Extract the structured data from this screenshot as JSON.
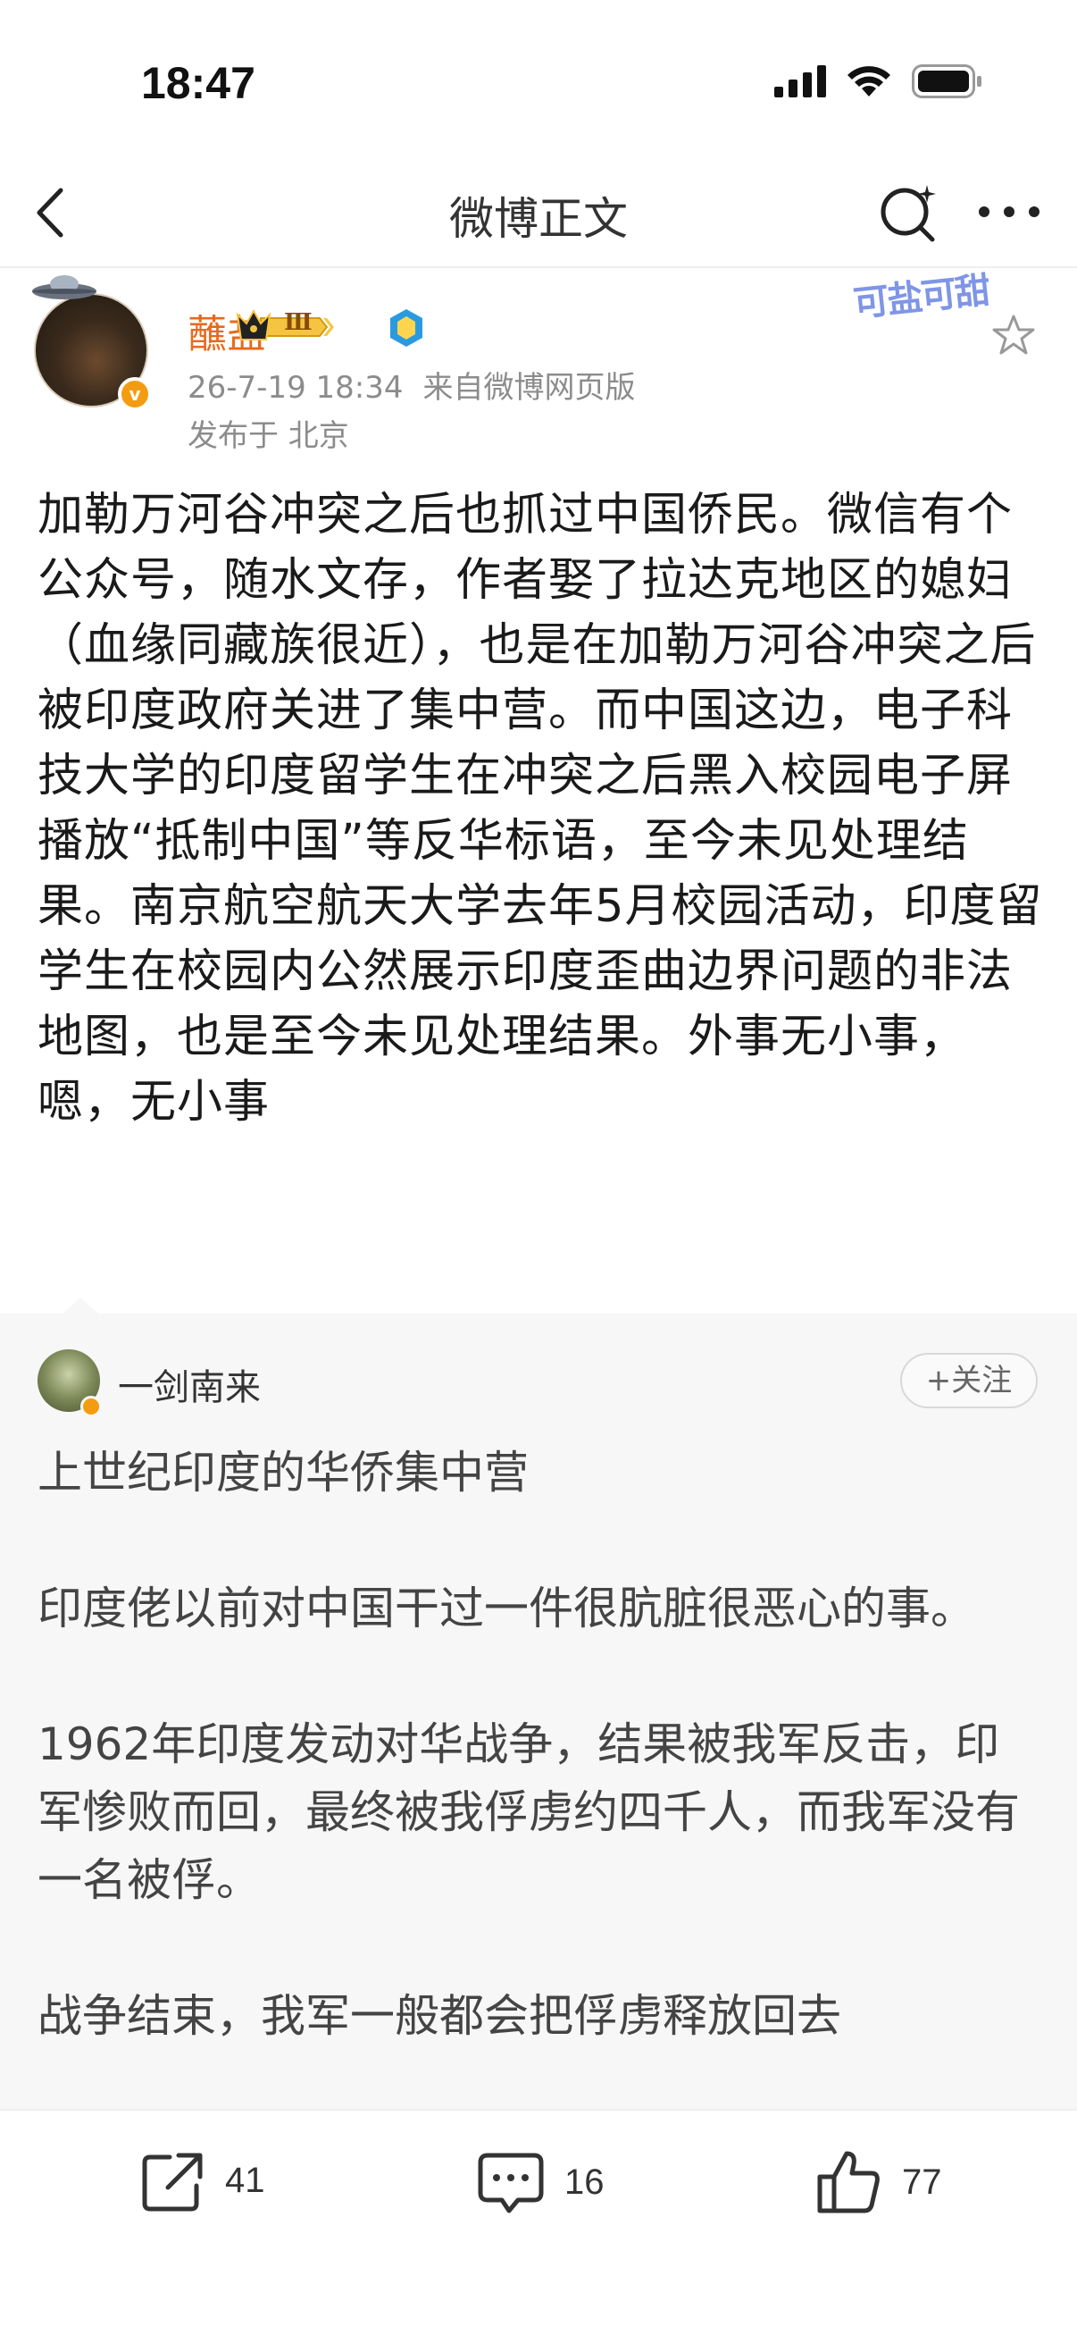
{
  "status_bar": {
    "time": "18:47"
  },
  "nav": {
    "title": "微博正文"
  },
  "post": {
    "author": "蘸盐",
    "level_badge": "Ⅲ",
    "timestamp": "26-7-19 18:34",
    "source": "来自微博网页版",
    "location": "发布于 北京",
    "sticker": "可盐可甜",
    "body": "加勒万河谷冲突之后也抓过中国侨民。微信有个公众号，随水文存，作者娶了拉达克地区的媳妇（血缘同藏族很近），也是在加勒万河谷冲突之后被印度政府关进了集中营。而中国这边，电子科技大学的印度留学生在冲突之后黑入校园电子屏播放“抵制中国”等反华标语，至今未见处理结果。南京航空航天大学去年5月校园活动，印度留学生在校园内公然展示印度歪曲边界问题的非法地图，也是至今未见处理结果。外事无小事，嗯，无小事"
  },
  "retweet": {
    "author": "一剑南来",
    "follow_label": "+关注",
    "paragraphs": [
      "上世纪印度的华侨集中营",
      "印度佬以前对中国干过一件很肮脏很恶心的事。",
      "1962年印度发动对华战争，结果被我军反击，印军惨败而回，最终被我俘虏约四千人，而我军没有一名被俘。",
      "战争结束，我军一般都会把俘虏释放回去"
    ]
  },
  "actions": {
    "share_count": "41",
    "comment_count": "16",
    "like_count": "77"
  },
  "colors": {
    "username": "#e66a1e",
    "meta": "#8c8c8c",
    "retweet_bg": "#f7f7f7"
  }
}
